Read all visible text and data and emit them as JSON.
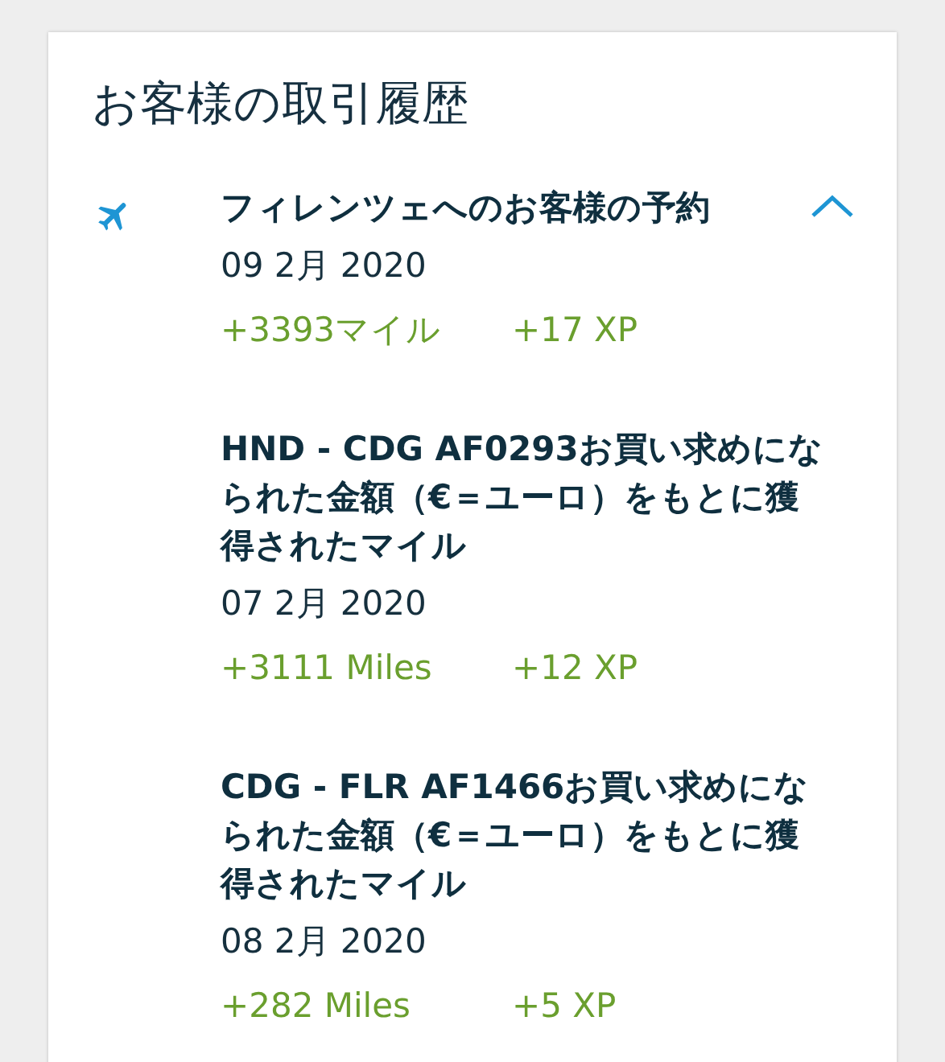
{
  "card": {
    "title": "お客様の取引履歴"
  },
  "booking": {
    "title": "フィレンツェへのお客様の予約",
    "date": "09 2月 2020",
    "miles": "+3393マイル",
    "xp": "+17 XP",
    "expanded": true
  },
  "transactions": [
    {
      "title": "HND - CDG AF0293お買い求めになられた金額（€＝ユーロ）をもとに獲得されたマイル",
      "date": "07 2月 2020",
      "miles": "+3111 Miles",
      "xp": "+12 XP"
    },
    {
      "title": "CDG - FLR AF1466お買い求めになられた金額（€＝ユーロ）をもとに獲得されたマイル",
      "date": "08 2月 2020",
      "miles": "+282 Miles",
      "xp": "+5 XP"
    }
  ]
}
